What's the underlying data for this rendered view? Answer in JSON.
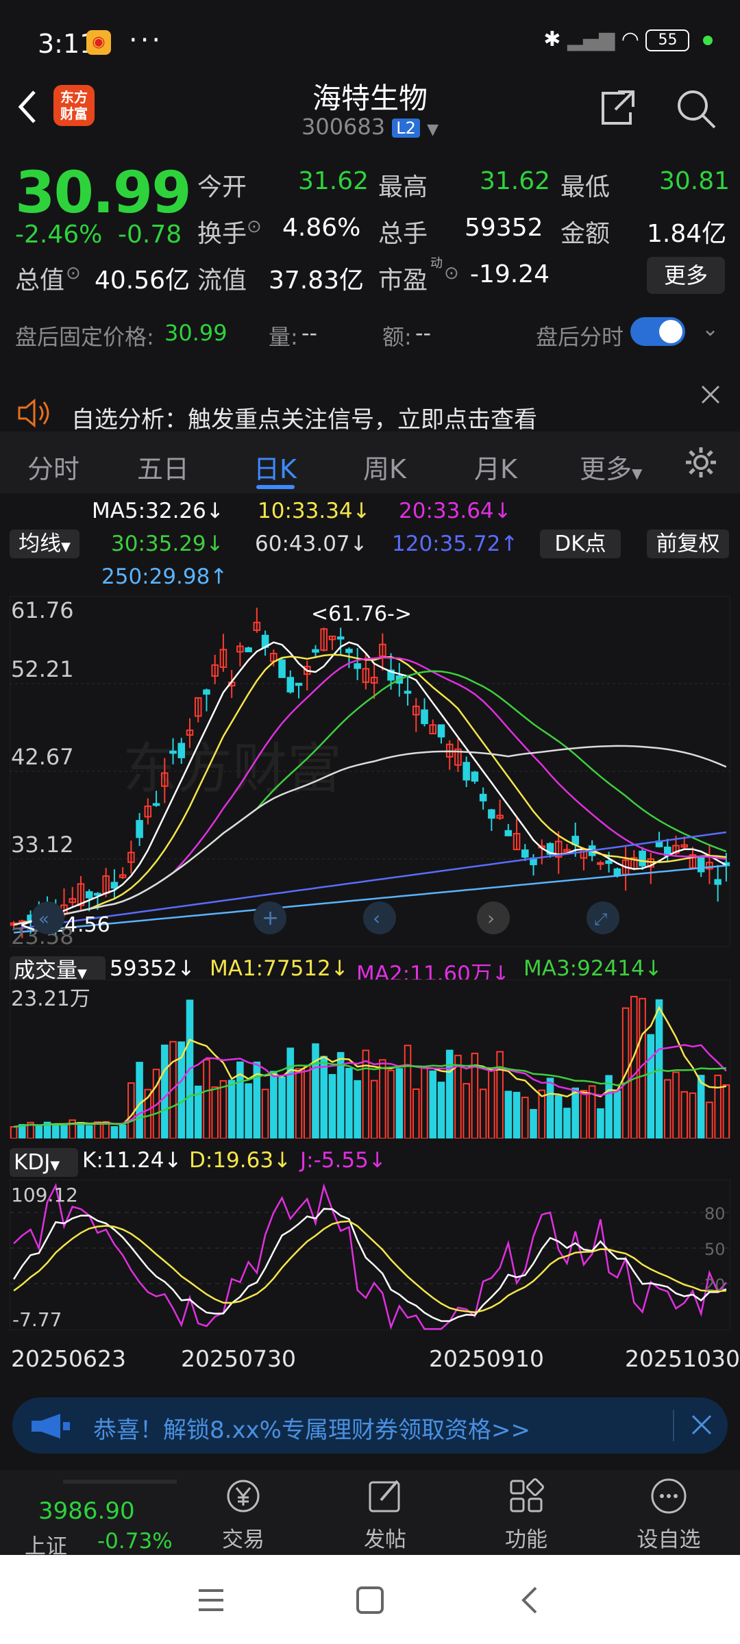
{
  "status": {
    "time": "3:11",
    "dots": "···",
    "battery": "55"
  },
  "header": {
    "title": "海特生物",
    "code": "300683",
    "level": "L2",
    "logo": "东方财富"
  },
  "quote": {
    "price": "30.99",
    "pct": "-2.46%",
    "chg": "-0.78",
    "open_label": "今开",
    "open": "31.62",
    "high_label": "最高",
    "high": "31.62",
    "low_label": "最低",
    "low": "30.81",
    "turnover_label": "换手",
    "turnover": "4.86%",
    "vol_label": "总手",
    "vol": "59352",
    "amt_label": "金额",
    "amt": "1.84亿",
    "mcap_label": "总值",
    "mcap": "40.56亿",
    "float_label": "流值",
    "float": "37.83亿",
    "pe_label": "市盈",
    "pe_sup": "动",
    "pe": "-19.24",
    "more": "更多"
  },
  "afterhours": {
    "label": "盘后固定价格:",
    "price": "30.99",
    "vol_label": "量:",
    "vol": "--",
    "amt_label": "额:",
    "amt": "--",
    "toggle_label": "盘后分时"
  },
  "notice": {
    "text": "自选分析：触发重点关注信号，立即点击查看"
  },
  "tabs": [
    "分时",
    "五日",
    "日K",
    "周K",
    "月K",
    "更多"
  ],
  "ma": {
    "select": "均线",
    "ma5": "MA5:32.26",
    "ma10": "10:33.34",
    "ma20": "20:33.64",
    "ma30": "30:35.29",
    "ma60": "60:43.07",
    "ma120": "120:35.72",
    "ma250": "250:29.98",
    "dk": "DK点",
    "adj": "前复权",
    "ma5_arrow": "↓",
    "ma10_arrow": "↓",
    "ma20_arrow": "↓",
    "ma30_arrow": "↓",
    "ma60_arrow": "↓",
    "ma120_arrow": "↑",
    "ma250_arrow": "↑"
  },
  "chart_labels": {
    "p1": "61.76",
    "p2": "52.21",
    "p3": "42.67",
    "p4": "33.12",
    "p5": "23.58",
    "hi": "61.76",
    "lo": "24.56",
    "watermark": "东方财富"
  },
  "volume": {
    "select": "成交量",
    "v": "59352",
    "v_arrow": "↓",
    "ma1": "MA1:77512",
    "ma1_arrow": "↓",
    "ma2": "MA2:11.60万",
    "ma2_arrow": "↓",
    "ma3": "MA3:92414",
    "ma3_arrow": "↓",
    "max": "23.21万"
  },
  "kdj": {
    "select": "KDJ",
    "k": "K:11.24",
    "k_arrow": "↓",
    "d": "D:19.63",
    "d_arrow": "↓",
    "j": "J:-5.55",
    "j_arrow": "↓",
    "max": "109.12",
    "min": "-7.77",
    "g80": "80",
    "g50": "50",
    "g20": "20"
  },
  "dates": [
    "20250623",
    "20250730",
    "20250910",
    "20251030"
  ],
  "banner": {
    "text": "恭喜！解锁8.xx%专属理财券领取资格>>"
  },
  "index": {
    "value": "3986.90",
    "name": "上证",
    "pct": "-0.73%"
  },
  "nav": [
    "交易",
    "发帖",
    "功能",
    "设自选"
  ],
  "colors": {
    "up": "#ff3b30",
    "down": "#2ed33c",
    "accent": "#3d8bff",
    "bg": "#141416",
    "candle_down": "#27d3e0",
    "ma5": "#ffffff",
    "ma10": "#f5e64a",
    "ma20": "#e030e0",
    "ma30": "#3ecf3e",
    "ma60": "#dcdcdc",
    "ma120": "#5a6cff",
    "ma250": "#5ab4ff"
  }
}
